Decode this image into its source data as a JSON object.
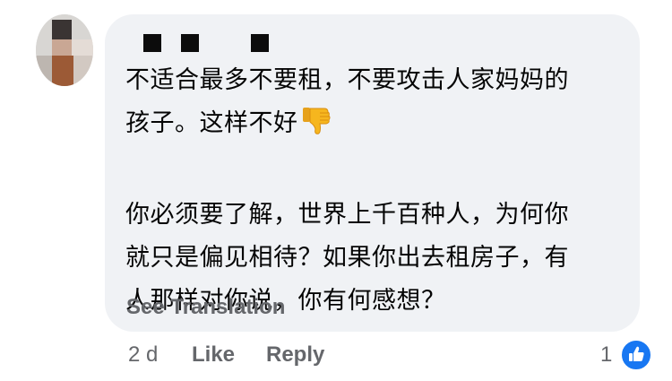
{
  "comment": {
    "line1": "不适合最多不要租，不要攻击人家妈妈的",
    "line2": "孩子。这样不好",
    "line2_emoji": "thumbs-down-icon",
    "line3": "你必须要了解，世界上千百种人，为何你",
    "line4": "就只是偏见相待？如果你出去租房子，有",
    "line5": "人那样对你说，你有何感想？"
  },
  "see_translation": "See Translation",
  "actions": {
    "time": "2 d",
    "like": "Like",
    "reply": "Reply"
  },
  "reaction": {
    "count": "1",
    "icon": "like-reaction-icon"
  },
  "author": {
    "name_redacted": true
  },
  "colors": {
    "bubble": "#f0f2f5",
    "text": "#050505",
    "secondary": "#65676b",
    "like_blue": "#1877f2"
  }
}
